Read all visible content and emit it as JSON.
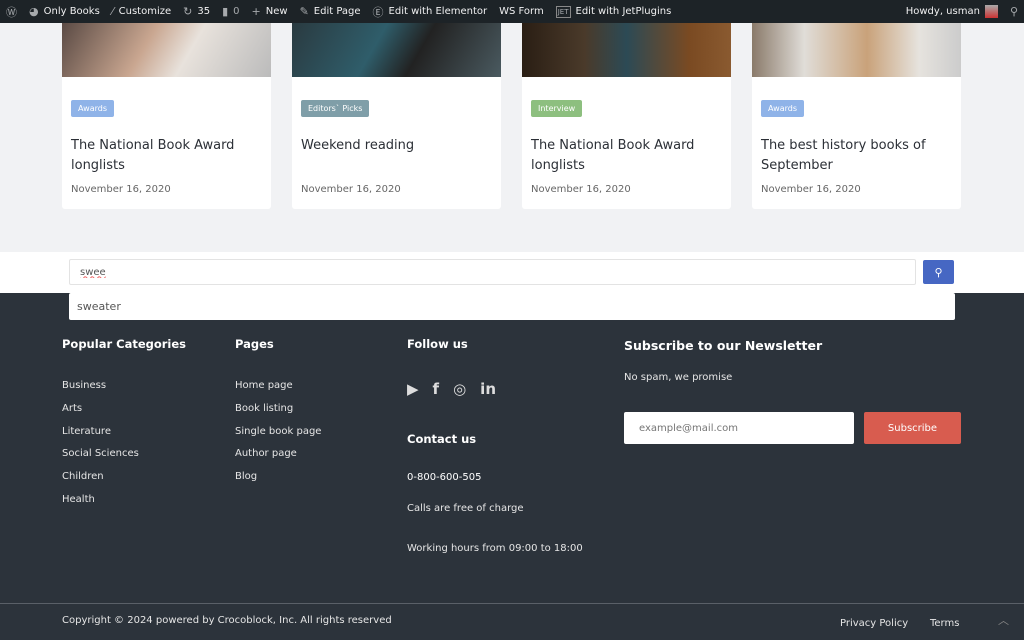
{
  "adminbar": {
    "items": [
      {
        "icon": "wordpress-icon",
        "label": ""
      },
      {
        "icon": "palette-icon",
        "label": "Only Books"
      },
      {
        "icon": "brush-icon",
        "label": "Customize"
      },
      {
        "icon": "updates-icon",
        "label": "35"
      },
      {
        "icon": "comment-icon",
        "label": "0"
      },
      {
        "icon": "plus-icon",
        "label": "New"
      },
      {
        "icon": "pencil-icon",
        "label": "Edit Page"
      },
      {
        "icon": "elementor-icon",
        "label": "Edit with Elementor"
      },
      {
        "icon": "",
        "label": "WS Form"
      },
      {
        "icon": "jetplugins-icon",
        "label": "Edit with JetPlugins"
      }
    ],
    "howdy": "Howdy, usman"
  },
  "cards": [
    {
      "tag": "Awards",
      "tag_color": "#8fb3e8",
      "title": "The National Book Award longlists",
      "date": "November 16, 2020"
    },
    {
      "tag": "Editors` Picks",
      "tag_color": "#7f9ea8",
      "title": "Weekend reading",
      "date": "November 16, 2020"
    },
    {
      "tag": "Interview",
      "tag_color": "#8dbf7f",
      "title": "The National Book Award longlists",
      "date": "November 16, 2020"
    },
    {
      "tag": "Awards",
      "tag_color": "#8fb3e8",
      "title": "The best history books of September",
      "date": "November 16, 2020"
    }
  ],
  "search": {
    "value": "swee",
    "suggestion": "sweater"
  },
  "footer": {
    "categories": {
      "title": "Popular Categories",
      "items": [
        "Business",
        "Arts",
        "Literature",
        "Social Sciences",
        "Children",
        "Health"
      ]
    },
    "pages": {
      "title": "Pages",
      "items": [
        "Home page",
        "Book listing",
        "Single book page",
        "Author page",
        "Blog"
      ]
    },
    "follow": {
      "title": "Follow us"
    },
    "contact": {
      "title": "Contact us",
      "phone": "0-800-600-505",
      "note": "Calls are free of charge",
      "hours": "Working hours from 09:00 to 18:00"
    },
    "newsletter": {
      "title": "Subscribe to our Newsletter",
      "subtitle": "No spam, we promise",
      "placeholder": "example@mail.com",
      "button": "Subscribe"
    },
    "copyright": "Copyright © 2024 powered by Crocoblock, Inc. All rights reserved",
    "links": [
      "Privacy Policy",
      "Terms"
    ]
  }
}
